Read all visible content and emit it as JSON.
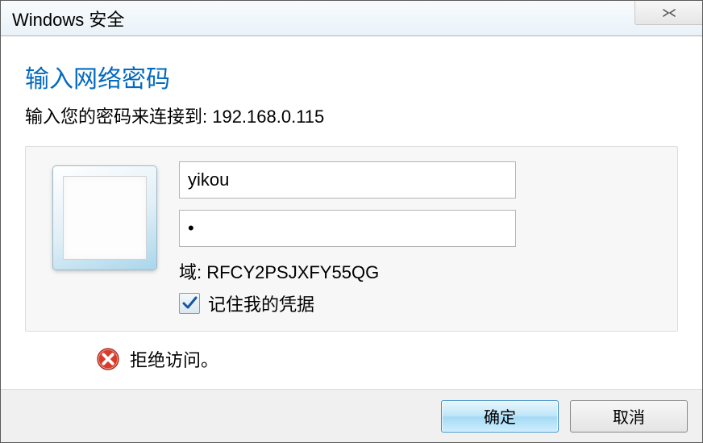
{
  "titlebar": {
    "title": "Windows 安全"
  },
  "heading": "输入网络密码",
  "subheading": "输入您的密码来连接到: 192.168.0.115",
  "credentials": {
    "username_value": "yikou",
    "password_value": "•",
    "domain_label": "域: RFCY2PSJXFY55QG",
    "remember_label": "记住我的凭据",
    "remember_checked": true
  },
  "status": {
    "message": "拒绝访问。"
  },
  "buttons": {
    "ok": "确定",
    "cancel": "取消"
  }
}
